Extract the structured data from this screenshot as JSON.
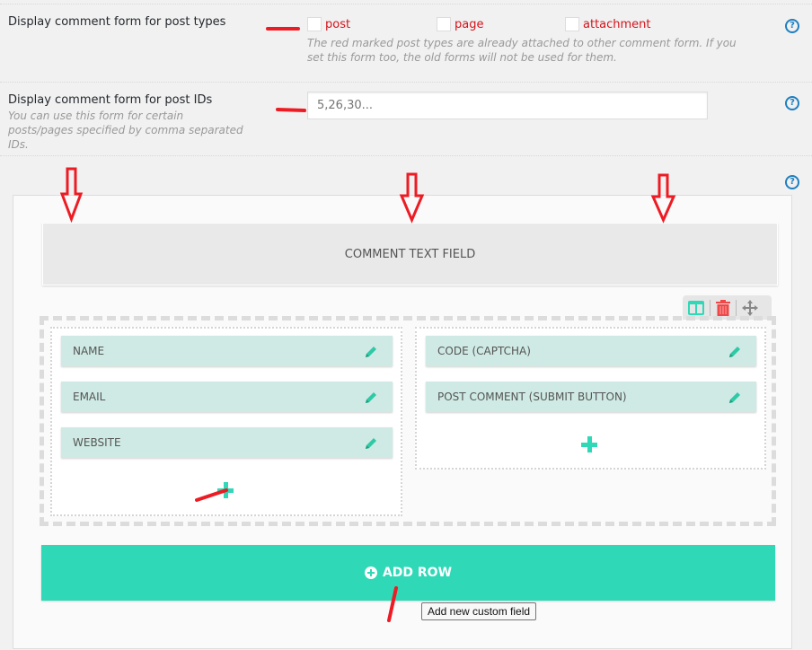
{
  "settings": {
    "post_types": {
      "label": "Display comment form for post types",
      "options": [
        {
          "label": "post",
          "checked": false
        },
        {
          "label": "page",
          "checked": false
        },
        {
          "label": "attachment",
          "checked": false
        }
      ],
      "note": "The red marked post types are already attached to other comment form. If you set this form too, the old forms will not be used for them.",
      "help_icon": "?"
    },
    "post_ids": {
      "label": "Display comment form for post IDs",
      "description": "You can use this form for certain posts/pages specified by comma separated IDs.",
      "placeholder": "5,26,30...",
      "value": "",
      "help_icon": "?"
    },
    "builder_help_icon": "?"
  },
  "builder": {
    "comment_text_field": "COMMENT TEXT FIELD",
    "row_toolbar": {
      "icons": [
        "columns-icon",
        "trash-icon",
        "move-icon"
      ]
    },
    "columns": [
      {
        "fields": [
          "NAME",
          "EMAIL",
          "WEBSITE"
        ],
        "add_icon": "plus-icon"
      },
      {
        "fields": [
          "CODE (CAPTCHA)",
          "POST COMMENT (SUBMIT BUTTON)"
        ],
        "add_icon": "plus-icon"
      }
    ],
    "add_row_label": "ADD ROW",
    "tooltip": "Add new custom field"
  },
  "colors": {
    "accent": "#2fd8b6",
    "field_bg": "#cfeae4",
    "red_marked": "#d3131b",
    "help_blue": "#1e7fc0",
    "trash_red": "#f04848",
    "annotation_red": "#ed1c24"
  }
}
